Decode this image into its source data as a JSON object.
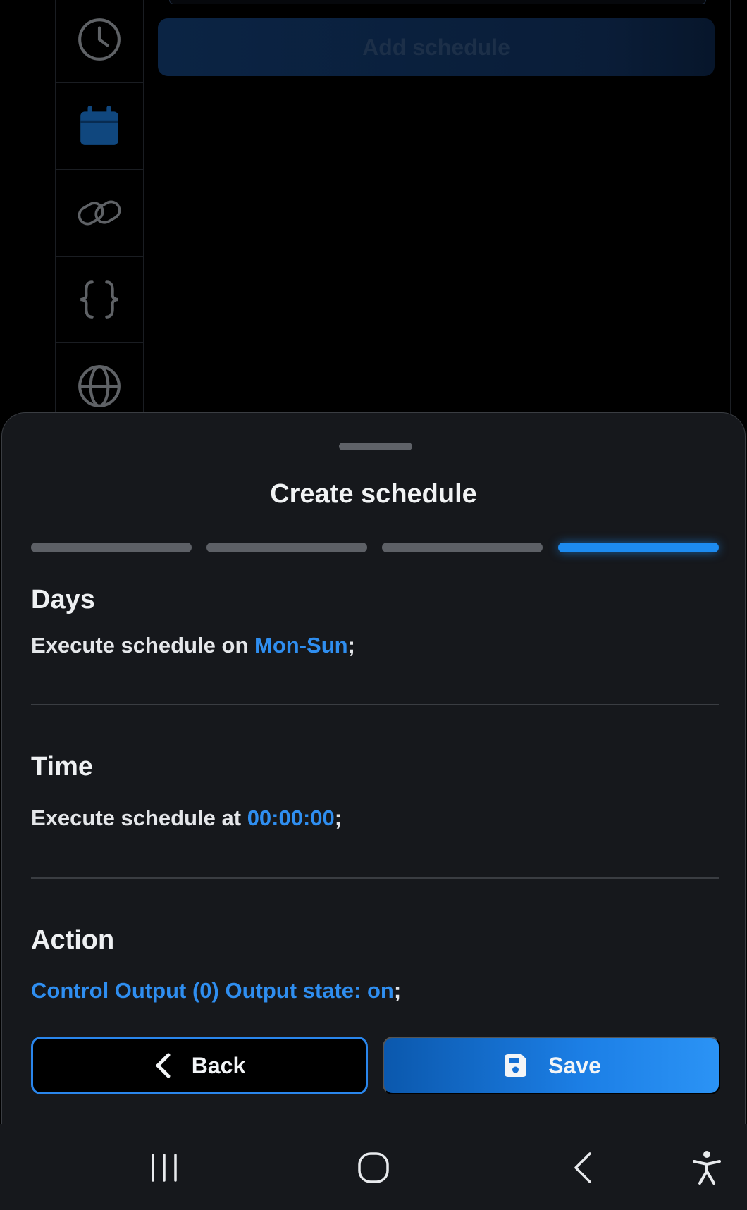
{
  "background": {
    "add_schedule_label": "Add schedule",
    "rail_icons": [
      "clock-icon",
      "calendar-icon",
      "link-icon",
      "braces-icon",
      "globe-icon"
    ]
  },
  "sheet": {
    "title": "Create schedule",
    "steps_total": 4,
    "step_active": 4,
    "days": {
      "heading": "Days",
      "prefix": "Execute schedule on ",
      "value": "Mon-Sun",
      "suffix": ";"
    },
    "time": {
      "heading": "Time",
      "prefix": "Execute schedule at ",
      "value": "00:00:00",
      "suffix": ";"
    },
    "action": {
      "heading": "Action",
      "value": "Control Output (0) Output state: on",
      "suffix": ";"
    },
    "back_label": "Back",
    "save_label": "Save"
  },
  "colors": {
    "accent": "#1d8bf0",
    "sheet_bg": "#16181c",
    "highlight_text": "#2f8ef0"
  }
}
